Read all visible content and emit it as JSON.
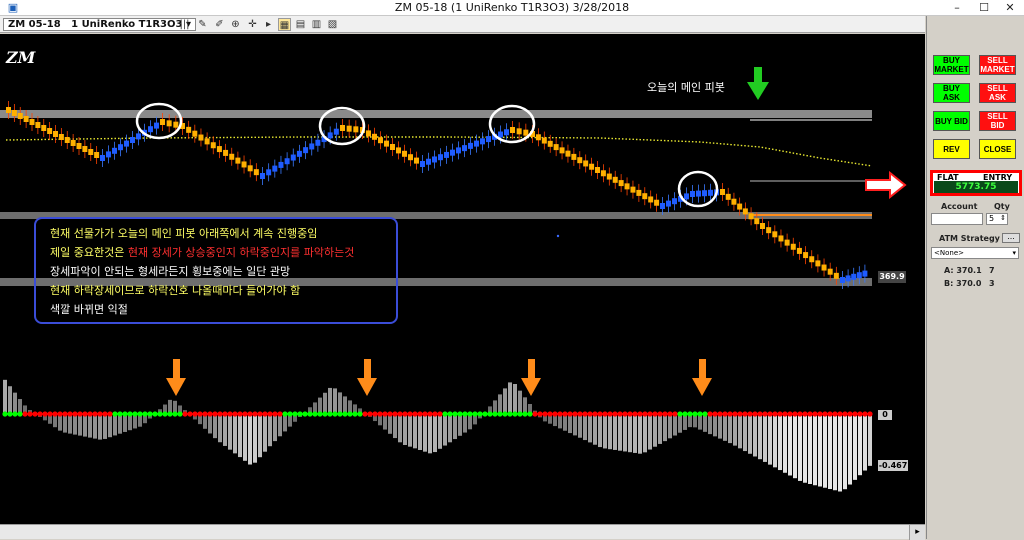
{
  "window": {
    "title": "ZM 05-18 (1 UniRenko T1R3O3)  3/28/2018",
    "minimize": "–",
    "maximize": "☐",
    "close": "✕"
  },
  "toolbar": {
    "instrument": "ZM 05-18",
    "period": "1 UniRenko T1R3O3"
  },
  "chart": {
    "symbol_label": "ZM",
    "pivot_label": "오늘의 메인 피봇",
    "price_tag": "369.9",
    "osc_zero": "0",
    "osc_value": "-0.467",
    "notes": [
      {
        "text": "현재 선물가가 오늘의 메인 피봇 아래쪽에서 계속 진행중임",
        "color": "#ffff66"
      },
      {
        "parts": [
          {
            "text": "제일 중요한것은 ",
            "color": "#ffff66"
          },
          {
            "text": "현재 장세가 상승중인지 하락중인지를 파악하는것",
            "color": "#ff3030"
          }
        ]
      },
      {
        "text": "장세파악이 안되는 형세라든지 횡보중에는 일단 관망",
        "color": "#ffffff"
      },
      {
        "text": "현재 하락장세이므로 하락신호 나올때마다 들어가야 함",
        "color": "#ffff66"
      },
      {
        "text": "색깔 바뀌면 익절",
        "color": "#ffffff"
      }
    ],
    "colors": {
      "up": "#1f5cff",
      "down": "#ffb000",
      "down_edge": "#ff4400",
      "circle": "#ffffff",
      "arrow": "#ff8c1a",
      "green_arrow": "#22cc22",
      "note_border": "#3b4dd8"
    }
  },
  "panel": {
    "buy_market": "BUY MARKET",
    "sell_market": "SELL MARKET",
    "buy_ask": "BUY ASK",
    "sell_ask": "SELL ASK",
    "buy_bid": "BUY BID",
    "sell_bid": "SELL BID",
    "rev": "REV",
    "close": "CLOSE",
    "flat": "FLAT",
    "entry": "ENTRY",
    "pnl": "5773.75",
    "account_label": "Account",
    "qty_label": "Qty",
    "qty": "5",
    "atm_label": "ATM Strategy",
    "atm_btn": "...",
    "atm_value": "<None>",
    "ask": "A: 370.1",
    "ask_size": "7",
    "bid": "B: 370.0",
    "bid_size": "3"
  }
}
